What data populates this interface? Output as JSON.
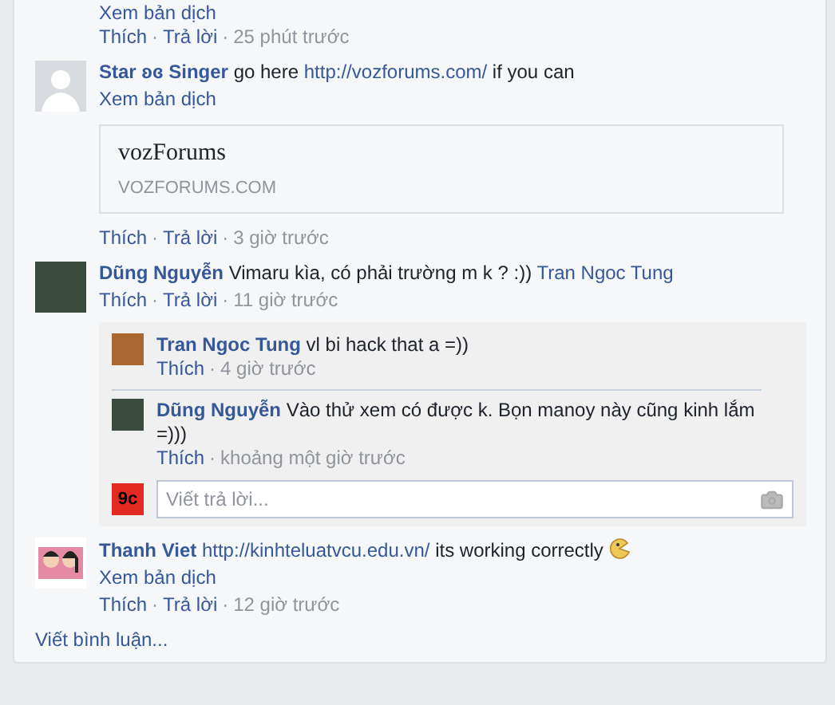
{
  "separator": "·",
  "comments": [
    {
      "kind": "partial",
      "translate": "Xem bản dịch",
      "actions": [
        "Thích",
        "Trả lời"
      ],
      "time": "25 phút trước"
    },
    {
      "kind": "comment",
      "avatar": {
        "kind": "silhouette"
      },
      "author": "Star ʚɞ Singer",
      "parts": [
        {
          "text": "go here",
          "link": false
        },
        {
          "text": "http://vozforums.com/",
          "link": true
        },
        {
          "text": "if you can",
          "link": false
        }
      ],
      "translate": "Xem bản dịch",
      "preview": {
        "title": "vozForums",
        "domain": "VOZFORUMS.COM"
      },
      "actions": [
        "Thích",
        "Trả lời"
      ],
      "time": "3 giờ trước"
    },
    {
      "kind": "comment",
      "avatar": {
        "kind": "photo"
      },
      "author": "Dũng Nguyễn",
      "parts": [
        {
          "text": "Vimaru kìa, có phải trường m k ? :))",
          "link": false
        },
        {
          "text": "Tran Ngoc Tung",
          "link": true
        }
      ],
      "actions": [
        "Thích",
        "Trả lời"
      ],
      "time": "11 giờ trước",
      "replies": [
        {
          "avatar": {
            "kind": "photo-warm"
          },
          "author": "Tran Ngoc Tung",
          "text": "vl bi hack that a =))",
          "actions": [
            "Thích"
          ],
          "time": "4 giờ trước"
        },
        {
          "avatar": {
            "kind": "photo"
          },
          "author": "Dũng Nguyễn",
          "text": "Vào thử xem có được k. Bọn manoy này cũng kinh lắm =)))",
          "actions": [
            "Thích"
          ],
          "time": "khoảng một giờ trước"
        }
      ],
      "reply_box": {
        "avatar_text": "9c",
        "placeholder": "Viết trả lời..."
      }
    },
    {
      "kind": "comment",
      "avatar": {
        "kind": "cartoon"
      },
      "author": "Thanh Viet",
      "parts": [
        {
          "text": "http://kinhteluatvcu.edu.vn/",
          "link": true
        },
        {
          "text": "its working correctly",
          "link": false
        }
      ],
      "emoji": true,
      "translate": "Xem bản dịch",
      "actions": [
        "Thích",
        "Trả lời"
      ],
      "time": "12 giờ trước"
    }
  ],
  "footer": "Viết bình luận..."
}
